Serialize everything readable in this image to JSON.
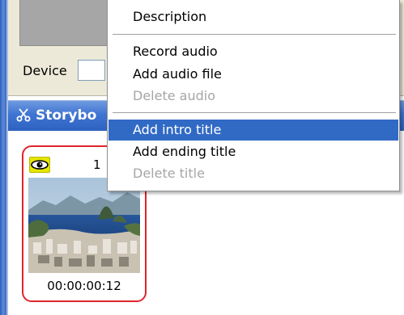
{
  "upper_panel": {
    "device_label": "Device",
    "device_value": ""
  },
  "storyboard": {
    "title": "Storybo",
    "clip": {
      "number": "1",
      "timecode": "00:00:00:12",
      "visibility_icon": "eye-icon",
      "selected_border_color": "#e0242b"
    }
  },
  "context_menu": {
    "highlight_color": "#316ac5",
    "groups": [
      [
        {
          "label": "Description",
          "enabled": true,
          "highlighted": false
        }
      ],
      [
        {
          "label": "Record audio",
          "enabled": true,
          "highlighted": false
        },
        {
          "label": "Add audio file",
          "enabled": true,
          "highlighted": false
        },
        {
          "label": "Delete audio",
          "enabled": false,
          "highlighted": false
        }
      ],
      [
        {
          "label": "Add intro title",
          "enabled": true,
          "highlighted": true
        },
        {
          "label": "Add ending title",
          "enabled": true,
          "highlighted": false
        },
        {
          "label": "Delete title",
          "enabled": false,
          "highlighted": false
        }
      ]
    ]
  }
}
